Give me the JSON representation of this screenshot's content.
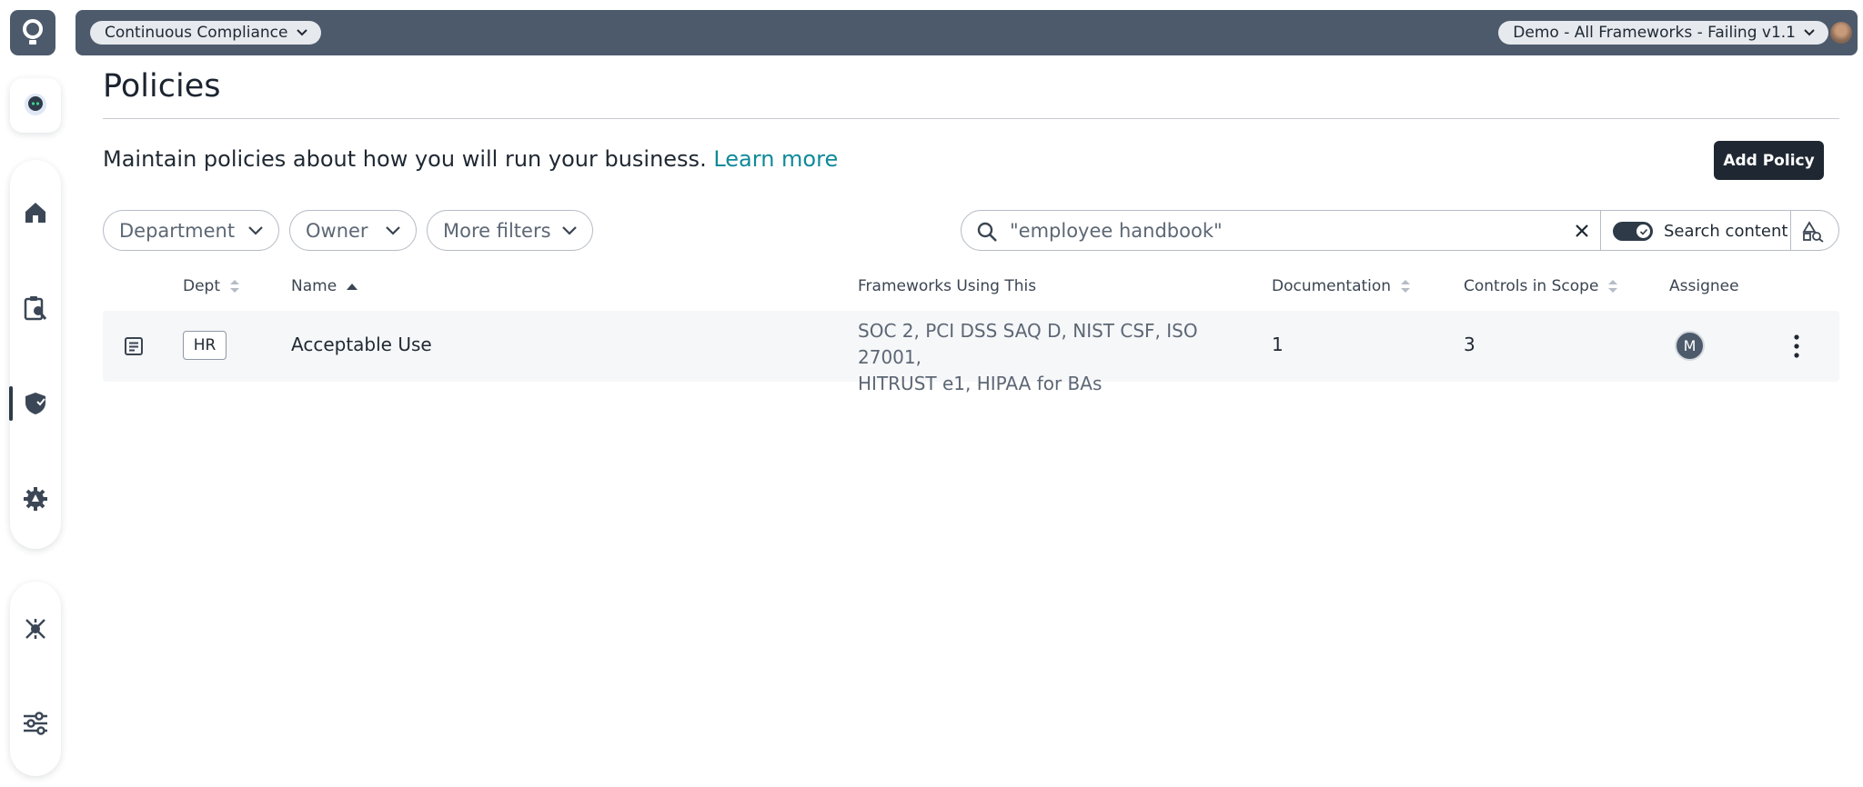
{
  "topbar": {
    "workspace": "Continuous Compliance",
    "framework": "Demo - All Frameworks - Failing v1.1"
  },
  "nav": {
    "logo": "drata-logo",
    "items": [
      "assistant",
      "home",
      "audits",
      "policies",
      "settings",
      "connections",
      "preferences"
    ],
    "active": "policies"
  },
  "page": {
    "title": "Policies",
    "description": "Maintain policies about how you will run your business.",
    "learn_more": "Learn more",
    "add_button": "Add Policy"
  },
  "filters": {
    "department": "Department",
    "owner": "Owner",
    "more": "More filters"
  },
  "search": {
    "value": "\"employee handbook\"",
    "content_toggle_label": "Search content",
    "content_toggle_on": true
  },
  "table": {
    "columns": {
      "dept": "Dept",
      "name": "Name",
      "frameworks": "Frameworks Using This",
      "documentation": "Documentation",
      "controls": "Controls in Scope",
      "assignee": "Assignee"
    },
    "rows": [
      {
        "dept": "HR",
        "name": "Acceptable Use",
        "frameworks_line1": "SOC 2, PCI DSS SAQ D, NIST CSF, ISO 27001,",
        "frameworks_line2": "HITRUST e1, HIPAA for BAs",
        "documentation": "1",
        "controls": "3",
        "assignee": "M"
      }
    ]
  }
}
